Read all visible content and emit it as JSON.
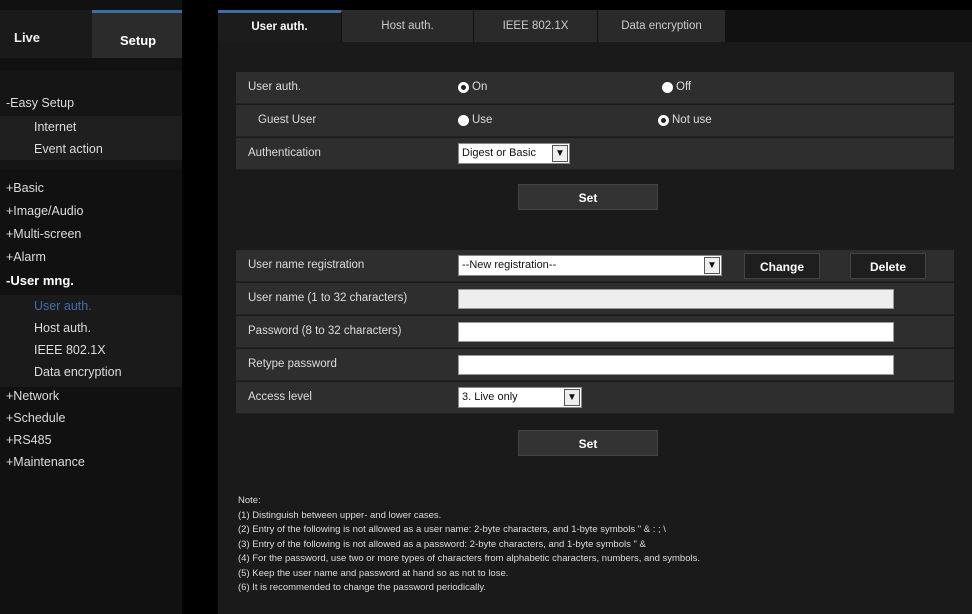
{
  "top_tabs": {
    "live": "Live",
    "setup": "Setup"
  },
  "sidebar": {
    "easy_setup": "-Easy Setup",
    "easy_items": [
      "Internet",
      "Event action"
    ],
    "groups": [
      "+Basic",
      "+Image/Audio",
      "+Multi-screen",
      "+Alarm"
    ],
    "user_mng": "-User mng.",
    "user_items": [
      "User auth.",
      "Host auth.",
      "IEEE 802.1X",
      "Data encryption"
    ],
    "groups2": [
      "+Network",
      "+Schedule",
      "+RS485",
      "+Maintenance"
    ]
  },
  "tabs": [
    "User auth.",
    "Host auth.",
    "IEEE 802.1X",
    "Data encryption"
  ],
  "auth": {
    "user_auth_label": "User auth.",
    "on": "On",
    "off": "Off",
    "guest_label": "Guest User",
    "use": "Use",
    "not_use": "Not use",
    "authentication_label": "Authentication",
    "authentication_value": "Digest or Basic",
    "set": "Set"
  },
  "reg": {
    "user_name_reg_label": "User name registration",
    "user_name_reg_value": "--New registration--",
    "change": "Change",
    "delete": "Delete",
    "user_name_label": "User name (1 to 32 characters)",
    "password_label": "Password (8 to 32 characters)",
    "retype_label": "Retype password",
    "access_label": "Access level",
    "access_value": "3. Live only",
    "set": "Set"
  },
  "notes": [
    "Note:",
    "(1) Distinguish between upper- and lower cases.",
    "(2) Entry of the following is not allowed as a user name:   2-byte characters, and 1-byte symbols \" & : ; \\",
    "(3) Entry of the following is not allowed as a password:   2-byte characters, and 1-byte symbols \" &",
    "(4) For the password, use two or more types of characters from alphabetic characters, numbers, and symbols.",
    "(5) Keep the user name and password at hand so as not to lose.",
    "(6) It is recommended to change the password periodically."
  ],
  "colors": {
    "accent": "#3a6ea5",
    "active_sidebar": "#3f6fb0"
  }
}
